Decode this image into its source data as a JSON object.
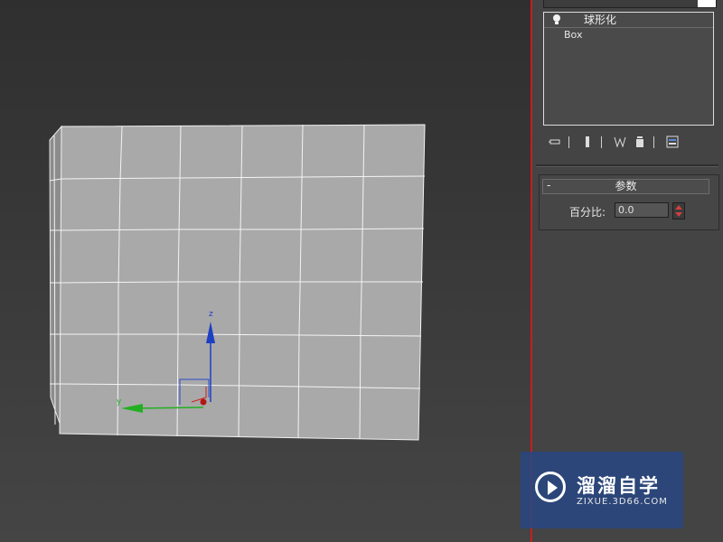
{
  "viewport": {
    "axis_labels": {
      "z": "z",
      "y": "y"
    },
    "mesh_color": "#a9a9a9",
    "wire_color": "#ffffff"
  },
  "panel": {
    "object_name": "",
    "modifier_stack": [
      {
        "label": "球形化",
        "type": "modifier",
        "icon": "lightbulb-icon"
      },
      {
        "label": "Box",
        "type": "base-object"
      }
    ],
    "toolbar_icons": [
      "pin-stack-icon",
      "show-end-result-icon",
      "make-unique-icon",
      "remove-modifier-icon",
      "configure-modifier-sets-icon"
    ],
    "rollout": {
      "title": "参数",
      "collapse_symbol": "-",
      "percent_label": "百分比:",
      "percent_value": "0.0"
    }
  },
  "watermark": {
    "title": "溜溜自学",
    "subtitle": "ZIXUE.3D66.COM"
  },
  "colors": {
    "divider": "#c81e1e",
    "axis_z": "#1d3fc4",
    "axis_y": "#22b022",
    "axis_x": "#c82020"
  }
}
